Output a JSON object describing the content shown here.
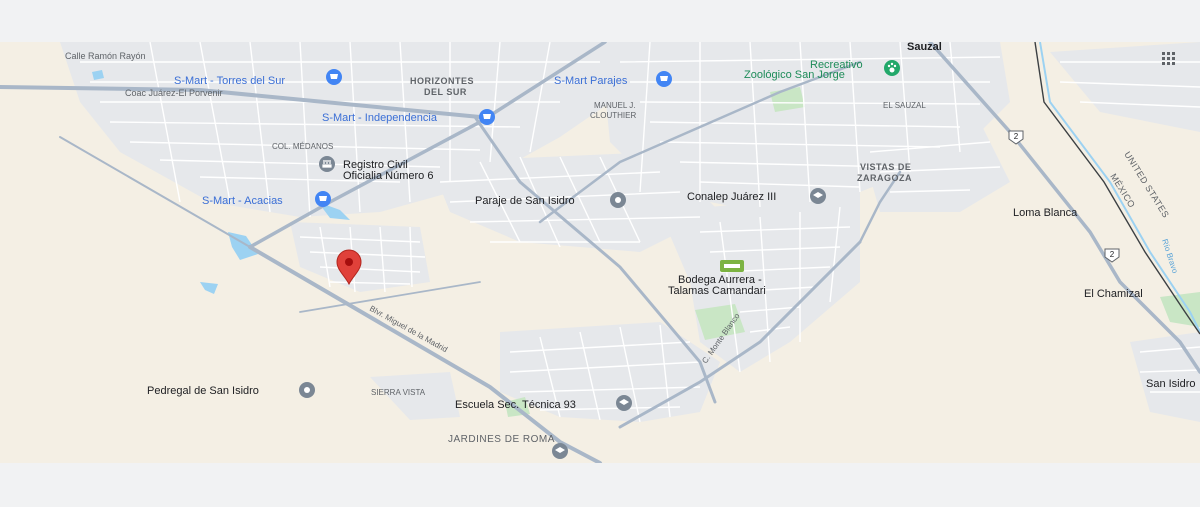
{
  "map": {
    "colors": {
      "background": "#f4efe4",
      "urban": "#e4e7ea",
      "road_major": "#a9b7c8",
      "road_minor": "#ffffff",
      "water": "#9cd2f2",
      "park": "#c7e7c6",
      "pin_red": "#e0413a",
      "poi_gray": "#7b8794",
      "shop_blue": "#4285f4",
      "zoo_green": "#22a86a",
      "text_dark": "#202124",
      "text_gray": "#5f6368",
      "text_blue": "#3b6fd6",
      "text_green": "#1e8c59"
    },
    "places": {
      "calle_ramon_rayon": "Calle Ramón Rayón",
      "smart_torres_del_sur": "S-Mart - Torres del Sur",
      "horizontes_del_sur_1": "HORIZONTES",
      "horizontes_del_sur_2": "DEL SUR",
      "smart_parajes": "S-Mart Parajes",
      "recreativo": "Recreativo",
      "zoologico": "Zoológico San Jorge",
      "sauzal": "Sauzal",
      "coac_juarez": "Coac Juárez-El Porvenir",
      "manuel_clouthier_1": "MANUEL J.",
      "manuel_clouthier_2": "CLOUTHIER",
      "el_sauzal": "EL SAUZAL",
      "smart_independencia": "S-Mart - Independencia",
      "col_medanos": "COL. MÉDANOS",
      "registro_civil_1": "Registro Civil",
      "registro_civil_2": "Oficialia Número 6",
      "vistas_zaragoza_1": "VISTAS DE",
      "vistas_zaragoza_2": "ZARAGOZA",
      "united_states": "UNITED STATES",
      "mexico": "MÉXICO",
      "smart_acacias": "S-Mart - Acacias",
      "paraje_san_isidro": "Paraje de San Isidro",
      "conalep": "Conalep Juárez III",
      "loma_blanca": "Loma Blanca",
      "rio_bravo": "Río Bravo",
      "bodega_1": "Bodega Aurrera -",
      "bodega_2": "Talamas Camandari",
      "el_chamizal": "El Chamizal",
      "blvd_miguel": "Blvr. Miguel de la Madrid",
      "c_monte_blanco": "C. Monte Blanco",
      "pedregal": "Pedregal de San Isidro",
      "sierra_vista": "SIERRA VISTA",
      "escuela": "Escuela Sec. Técnica 93",
      "san_isidro": "San Isidro",
      "jardines_roma": "JARDINES DE ROMA"
    },
    "highway_shields": [
      "2",
      "2"
    ],
    "icons": {
      "selected_pin": "location-pin-icon",
      "shopping": "shopping-cart-icon",
      "zoo": "paw-icon",
      "government": "government-building-icon",
      "school": "graduation-cap-icon",
      "place": "place-pin-icon",
      "store": "store-icon",
      "apps": "apps-grid-icon"
    }
  }
}
